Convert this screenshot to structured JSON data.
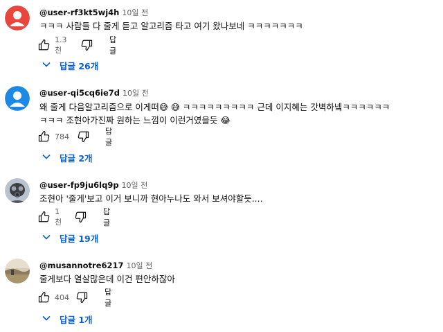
{
  "comments": [
    {
      "author": "@user-rf3kt5wj4h",
      "time": "10일 전",
      "lines": [
        "ㅋㅋㅋ 사람들 다 줄게 듣고 알고리즘 타고 여기 왔나보네 ㅋㅋㅋㅋㅋㅋㅋ"
      ],
      "likes": "1.3천",
      "reply_label": "답글",
      "replies_label": "답글 26개",
      "avatar": {
        "type": "default",
        "color": "#e8453c"
      }
    },
    {
      "author": "@user-qi5cq6ie7d",
      "time": "10일 전",
      "lines": [
        "왜 줄게 다음알고리즘으로 이게떠😅 😅 ㅋㅋㅋㅋㅋㅋㅋㅋㅋ 근데 이지혜는 갓벽하넼ㅋㅋㅋㅋㅋㅋ",
        "ㅋㅋㅋ 조현아가진짜 원하는 느낌이 이런거였을듯 😂"
      ],
      "likes": "784",
      "reply_label": "답글",
      "replies_label": "답글 2개",
      "avatar": {
        "type": "default",
        "color": "#1e88e5"
      }
    },
    {
      "author": "@user-fp9ju6lq9p",
      "time": "10일 전",
      "lines": [
        "조현아 '줄게'보고 이거 보니까 현아누나도 와서 보셔야할듯...."
      ],
      "likes": "1천",
      "reply_label": "답글",
      "replies_label": "답글 19개",
      "avatar": {
        "type": "gasmask-photo",
        "color": "#b9c3cf"
      }
    },
    {
      "author": "@musannotre6217",
      "time": "10일 전",
      "lines": [
        "줄게보다 열살많은데 이건 편안하잖아"
      ],
      "likes": "404",
      "reply_label": "답글",
      "replies_label": "답글 1개",
      "avatar": {
        "type": "landscape-photo",
        "color": "#c9b89a"
      }
    }
  ],
  "colors": {
    "link_blue": "#065fd4",
    "meta_gray": "#606060"
  }
}
